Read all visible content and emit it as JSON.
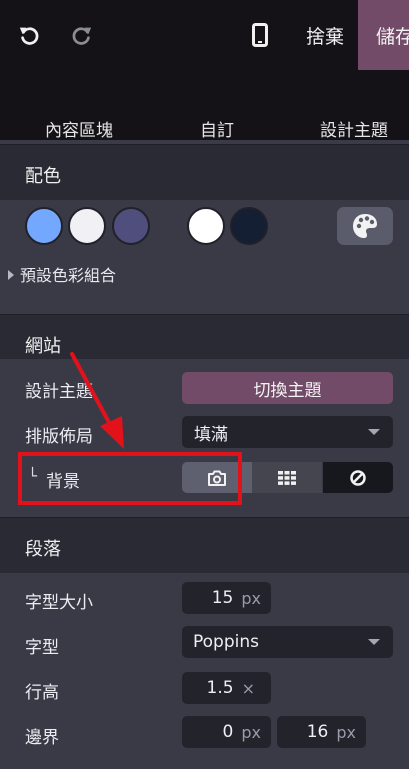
{
  "topbar": {
    "undo_icon": "undo-icon",
    "redo_icon": "redo-icon",
    "mobile_icon": "mobile-phone-icon",
    "discard_label": "捨棄",
    "save_label": "儲存"
  },
  "tabs": [
    {
      "label": "內容區塊"
    },
    {
      "label": "自訂"
    },
    {
      "label": "設計主題"
    }
  ],
  "colors": {
    "title": "配色",
    "swatches": [
      "#74a8ff",
      "#f1f1f5",
      "#4f4e7d",
      "#ffffff",
      "#141f33"
    ],
    "palette_icon": "palette-icon",
    "preset_label": "預設色彩組合"
  },
  "website": {
    "title": "網站",
    "theme_label": "設計主題",
    "theme_button": "切換主題",
    "layout_label": "排版佈局",
    "layout_value": "填滿",
    "bg_prefix": "└",
    "bg_label": "背景",
    "bg_options": [
      "camera-icon",
      "grid-icon",
      "none-icon"
    ]
  },
  "paragraph": {
    "title": "段落",
    "font_size_label": "字型大小",
    "font_size_value": "15",
    "font_size_unit": "px",
    "font_label": "字型",
    "font_value": "Poppins",
    "line_height_label": "行高",
    "line_height_value": "1.5",
    "line_height_unit": "×",
    "margin_label": "邊界",
    "margin_top_value": "0",
    "margin_top_unit": "px",
    "margin_bottom_value": "16",
    "margin_bottom_unit": "px"
  },
  "annotation": {
    "color": "#e3111a"
  },
  "accent": {
    "brand": "#714b67"
  }
}
